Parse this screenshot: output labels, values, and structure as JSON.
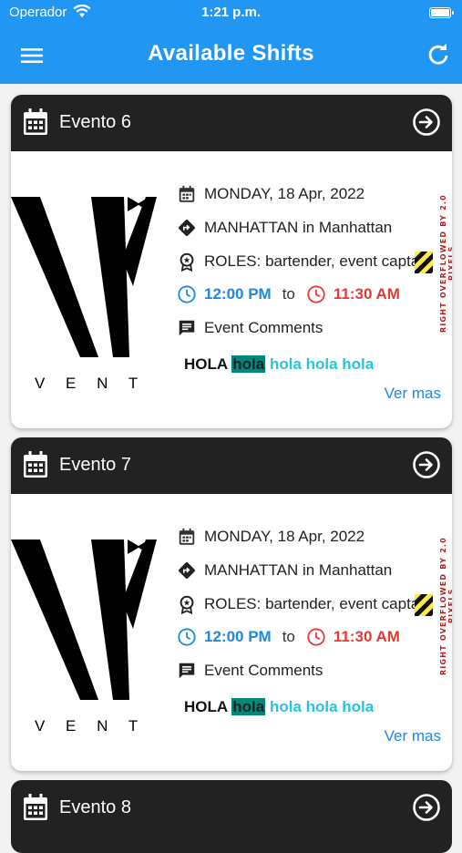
{
  "status_bar": {
    "carrier": "Operador",
    "time": "1:21 p.m."
  },
  "app_bar": {
    "title": "Available Shifts"
  },
  "shifts": [
    {
      "name": "Evento 6",
      "date": "MONDAY, 18 Apr, 2022",
      "location": "MANHATTAN in Manhattan",
      "roles": "ROLES: bartender, event captain",
      "start_time": "12:00 PM",
      "to_label": "to",
      "end_time": "11:30 AM",
      "comments_label": "Event Comments",
      "comment_preview": {
        "w1": "HOLA",
        "w2": "hola",
        "w3": "hola hola hola"
      },
      "logo_text": "V E N T",
      "overflow_warning": "RIGHT OVERFLOWED BY 2.0 PIXELS",
      "see_more": "Ver mas"
    },
    {
      "name": "Evento 7",
      "date": "MONDAY, 18 Apr, 2022",
      "location": "MANHATTAN in Manhattan",
      "roles": "ROLES: bartender, event captain",
      "start_time": "12:00 PM",
      "to_label": "to",
      "end_time": "11:30 AM",
      "comments_label": "Event Comments",
      "comment_preview": {
        "w1": "HOLA",
        "w2": "hola",
        "w3": "hola hola hola"
      },
      "logo_text": "V E N T",
      "overflow_warning": "RIGHT OVERFLOWED BY 2.0 PIXELS",
      "see_more": "Ver mas"
    },
    {
      "name": "Evento 8"
    }
  ],
  "colors": {
    "app_bar": "#2196f3",
    "card_header": "#222222",
    "start_time": "#1e88e5",
    "end_time": "#e53935",
    "link": "#1e88e5",
    "highlight": "#00897b",
    "comment_accent": "#26c6da"
  },
  "icons": [
    "wifi-icon",
    "battery-icon",
    "menu-icon",
    "refresh-icon",
    "calendar-icon",
    "arrow-circle-right-icon",
    "event-icon",
    "directions-icon",
    "badge-icon",
    "clock-icon",
    "comment-icon"
  ]
}
